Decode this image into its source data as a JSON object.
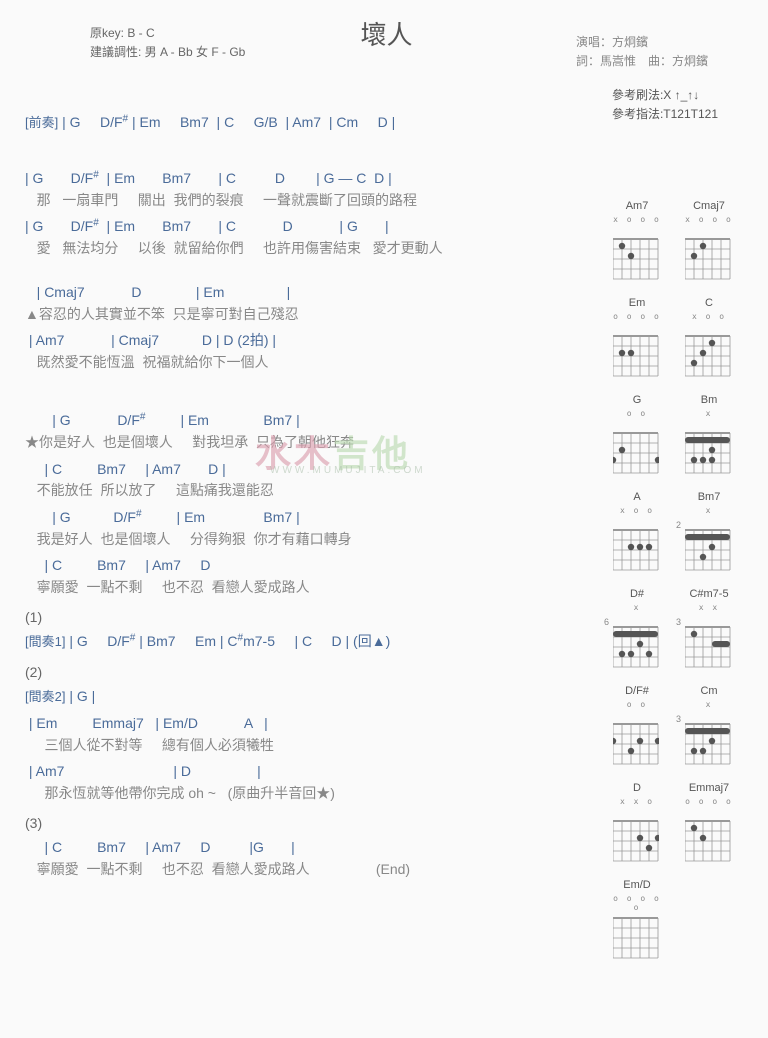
{
  "title": "壞人",
  "header_left": {
    "key": "原key: B - C",
    "suggest": "建議調性: 男 A - Bb 女 F - Gb"
  },
  "header_right": {
    "singer": "演唱：方炯鑌",
    "credit": "詞：馬嵩惟　曲：方炯鑌"
  },
  "reference": {
    "strum": "參考刷法:X ↑_↑↓",
    "finger": "參考指法:T121T121"
  },
  "intro": {
    "label": "[前奏]",
    "chords": " | G     D/F",
    "sharp": "#",
    "chords2": " | Em     Bm7  | C     G/B  | Am7  | Cm     D |"
  },
  "verse1": {
    "l1c": "| G       D/F",
    "l1sharp": "#",
    "l1c2": "  | Em       Bm7       | C          D        | G — C  D |",
    "l1t": "   那   一扇車門     關出  我們的裂痕     一聲就震斷了回頭的路程",
    "l2c": "| G       D/F",
    "l2sharp": "#",
    "l2c2": "  | Em       Bm7       | C            D            | G       |",
    "l2t": "   愛   無法均分     以後  就留給你們     也許用傷害結束   愛才更動人"
  },
  "pre": {
    "l1c": "   | Cmaj7            D              | Em                |",
    "l1t": "▲容忍的人其實並不笨  只是寧可對自己殘忍",
    "l2c": " | Am7            | Cmaj7           D | D (2拍) |",
    "l2t": "   既然愛不能恆溫  祝福就給你下一個人"
  },
  "chorus": {
    "l1c": "       | G            D/F",
    "l1sharp": "#",
    "l1c2": "         | Em              Bm7 |",
    "l1t": "★你是好人  也是個壞人     對我坦承  只為了朝他狂奔",
    "l2c": "     | C         Bm7     | Am7       D |",
    "l2t": "   不能放任  所以放了     這點痛我還能忍",
    "l3c": "       | G           D/F",
    "l3sharp": "#",
    "l3c2": "         | Em               Bm7 |",
    "l3t": "   我是好人  也是個壞人     分得夠狠  你才有藉口轉身",
    "l4c": "     | C         Bm7     | Am7     D",
    "l4t": "   寧願愛  一點不剩     也不忍  看戀人愛成路人"
  },
  "n1": "(1)",
  "inter1": {
    "label": "[間奏1]",
    "chords": " | G     D/F",
    "sharp": "#",
    "chords2": " | Bm7     Em | C",
    "sharp2": "#",
    "chords3": "m7-5     | C     D | (回▲)"
  },
  "n2": "(2)",
  "inter2": {
    "label": "[間奏2]",
    "chords": " | G |",
    "l1c": " | Em         Emmaj7   | Em/D            A   |",
    "l1t": "     三個人從不對等     總有個人必須犧牲",
    "l2c": " | Am7                            | D                 |",
    "l2t": "     那永恆就等他帶你完成 oh ~   (原曲升半音回★)"
  },
  "n3": "(3)",
  "ending": {
    "l1c": "     | C         Bm7     | Am7     D          |G       |",
    "l1t": "   寧願愛  一點不剩     也不忍  看戀人愛成路人",
    "end": "(End)"
  },
  "watermark": {
    "t1": "水",
    "t2": "木",
    "t3": "吉他",
    "sub": "WWW.MUMUJITA.COM"
  },
  "diagrams": [
    [
      {
        "name": "Am7",
        "top": "x o   o o",
        "dots": [
          [
            9,
            21
          ],
          [
            18,
            31
          ]
        ],
        "fret": ""
      },
      {
        "name": "Cmaj7",
        "top": "x     o o o",
        "dots": [
          [
            18,
            21
          ],
          [
            9,
            31
          ]
        ],
        "fret": ""
      }
    ],
    [
      {
        "name": "Em",
        "top": "o     o o o",
        "dots": [
          [
            9,
            31
          ],
          [
            18,
            31
          ]
        ],
        "fret": ""
      },
      {
        "name": "C",
        "top": "x     o   o",
        "dots": [
          [
            27,
            21
          ],
          [
            18,
            31
          ],
          [
            9,
            41
          ]
        ],
        "fret": ""
      }
    ],
    [
      {
        "name": "G",
        "top": "      o o",
        "dots": [
          [
            9,
            31
          ],
          [
            0,
            41
          ],
          [
            45,
            41
          ]
        ],
        "fret": ""
      },
      {
        "name": "Bm",
        "top": "x",
        "bar": 21,
        "dots": [
          [
            27,
            31
          ],
          [
            9,
            41
          ],
          [
            18,
            41
          ],
          [
            27,
            41
          ]
        ],
        "fret": ""
      }
    ],
    [
      {
        "name": "A",
        "top": "x o       o",
        "dots": [
          [
            18,
            31
          ],
          [
            27,
            31
          ],
          [
            36,
            31
          ]
        ],
        "fret": ""
      },
      {
        "name": "Bm7",
        "top": "x",
        "bar": 21,
        "dots": [
          [
            27,
            31
          ],
          [
            18,
            41
          ]
        ],
        "fret": "2"
      }
    ],
    [
      {
        "name": "D#",
        "top": "x",
        "bar": 21,
        "dots": [
          [
            27,
            31
          ],
          [
            36,
            41
          ],
          [
            18,
            41
          ],
          [
            9,
            41
          ]
        ],
        "fret": "6"
      },
      {
        "name": "C#m7-5",
        "top": "x   x",
        "bar2": [
          27,
          45,
          31
        ],
        "dots": [
          [
            9,
            21
          ]
        ],
        "fret": "3"
      }
    ],
    [
      {
        "name": "D/F#",
        "top": "    o   o",
        "dots": [
          [
            27,
            31
          ],
          [
            0,
            31
          ],
          [
            45,
            31
          ],
          [
            18,
            41
          ]
        ],
        "fret": ""
      },
      {
        "name": "Cm",
        "top": "x",
        "bar": 21,
        "dots": [
          [
            27,
            31
          ],
          [
            9,
            41
          ],
          [
            18,
            41
          ]
        ],
        "fret": "3"
      }
    ],
    [
      {
        "name": "D",
        "top": "x x o",
        "dots": [
          [
            27,
            31
          ],
          [
            45,
            31
          ],
          [
            36,
            41
          ]
        ],
        "fret": ""
      },
      {
        "name": "Emmaj7",
        "top": "o   o o o",
        "dots": [
          [
            9,
            21
          ],
          [
            18,
            31
          ]
        ],
        "fret": ""
      }
    ],
    [
      {
        "name": "Em/D",
        "top": "  o o o o o",
        "dots": [],
        "fret": ""
      }
    ]
  ]
}
